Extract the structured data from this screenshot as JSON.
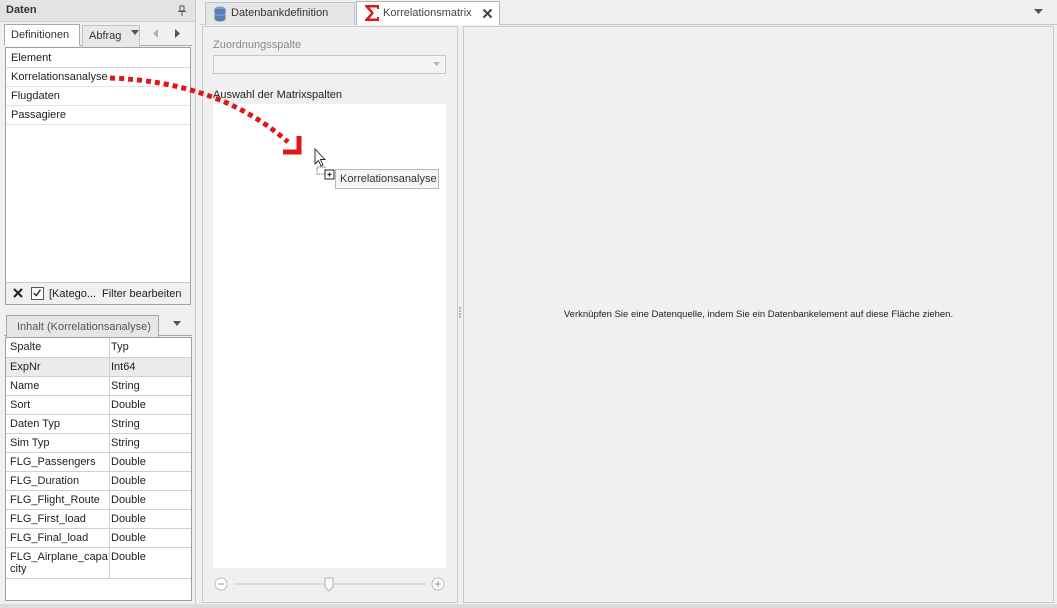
{
  "left_panel": {
    "title": "Daten",
    "tabs": [
      {
        "label": "Definitionen",
        "active": true
      },
      {
        "label": "Abfrag",
        "active": false
      }
    ],
    "element_list": {
      "header": "Element",
      "items": [
        "Korrelationsanalyse",
        "Flugdaten",
        "Passagiere"
      ]
    },
    "filter": {
      "category_label": "[Katego...",
      "edit_label": "Filter bearbeiten"
    },
    "content_tab": "Inhalt (Korrelationsanalyse)",
    "columns_grid": {
      "headers": [
        "Spalte",
        "Typ"
      ],
      "rows": [
        {
          "spalte": "ExpNr",
          "typ": "Int64"
        },
        {
          "spalte": "Name",
          "typ": "String"
        },
        {
          "spalte": "Sort",
          "typ": "Double"
        },
        {
          "spalte": "Daten Typ",
          "typ": "String"
        },
        {
          "spalte": "Sim Typ",
          "typ": "String"
        },
        {
          "spalte": "FLG_Passengers",
          "typ": "Double"
        },
        {
          "spalte": "FLG_Duration",
          "typ": "Double"
        },
        {
          "spalte": "FLG_Flight_Route",
          "typ": "Double"
        },
        {
          "spalte": "FLG_First_load",
          "typ": "Double"
        },
        {
          "spalte": "FLG_Final_load",
          "typ": "Double"
        },
        {
          "spalte": "FLG_Airplane_capa\ncity",
          "typ": "Double"
        }
      ]
    }
  },
  "document_tabs": [
    {
      "label": "Datenbankdefinition",
      "icon": "database-icon",
      "active": false
    },
    {
      "label": "Korrelationsmatrix",
      "icon": "sigma-icon",
      "active": true
    }
  ],
  "config": {
    "zuordnung_label": "Zuordnungsspalte",
    "zuordnung_value": "",
    "matrix_label": "Auswahl der Matrixspalten"
  },
  "drop_area": {
    "hint": "Verknüpfen Sie eine Datenquelle, indem Sie ein Datenbankelement auf diese Fläche ziehen."
  },
  "drag": {
    "tooltip": "Korrelationsanalyse"
  },
  "colors": {
    "accent_red": "#e0161b",
    "db_icon_blue": "#5a7fb0",
    "panel_bg": "#f0f0f0"
  }
}
